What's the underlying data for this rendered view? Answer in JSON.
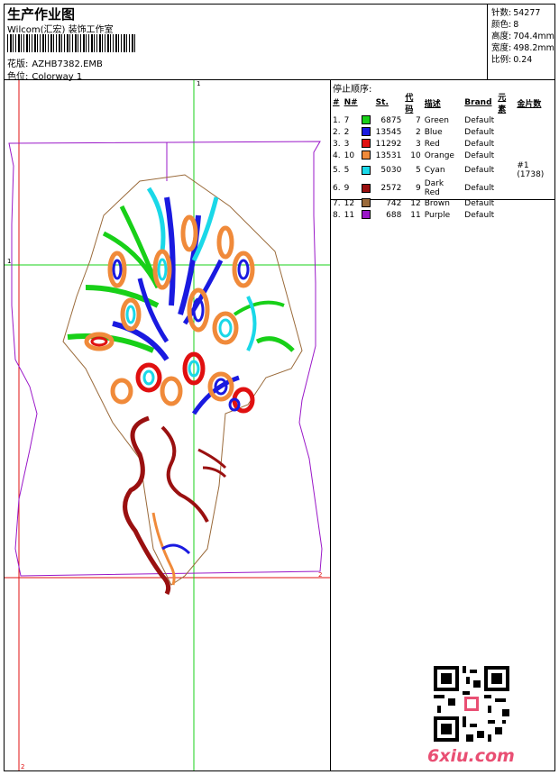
{
  "header": {
    "title": "生产作业图",
    "company": "Wilcom(汇宏) 装饰工作室",
    "design_label": "花版:",
    "design_value": "AZHB7382.EMB",
    "colorway_label": "色位:",
    "colorway_value": "Colorway 1"
  },
  "stats": [
    {
      "label": "针数:",
      "value": "54277"
    },
    {
      "label": "颜色:",
      "value": "8"
    },
    {
      "label": "高度:",
      "value": "704.4mm"
    },
    {
      "label": "宽度:",
      "value": "498.2mm"
    },
    {
      "label": "比例:",
      "value": "0.24"
    }
  ],
  "sequence": {
    "title": "停止顺序:",
    "headers": [
      "#",
      "N#",
      "St.",
      "代码",
      "描述",
      "Brand",
      "元素",
      "金片数"
    ],
    "rows": [
      {
        "no": "1.",
        "n": "7",
        "color": "#18d018",
        "st": "6875",
        "code": "7",
        "desc": "Green",
        "brand": "Default",
        "elem": "",
        "sequin": ""
      },
      {
        "no": "2.",
        "n": "2",
        "color": "#1a1ae0",
        "st": "13545",
        "code": "2",
        "desc": "Blue",
        "brand": "Default",
        "elem": "",
        "sequin": ""
      },
      {
        "no": "3.",
        "n": "3",
        "color": "#e01010",
        "st": "11292",
        "code": "3",
        "desc": "Red",
        "brand": "Default",
        "elem": "",
        "sequin": ""
      },
      {
        "no": "4.",
        "n": "10",
        "color": "#f08a3a",
        "st": "13531",
        "code": "10",
        "desc": "Orange",
        "brand": "Default",
        "elem": "",
        "sequin": ""
      },
      {
        "no": "5.",
        "n": "5",
        "color": "#1ad8e8",
        "st": "5030",
        "code": "5",
        "desc": "Cyan",
        "brand": "Default",
        "elem": "",
        "sequin": "#1 (1738)"
      },
      {
        "no": "6.",
        "n": "9",
        "color": "#9a1010",
        "st": "2572",
        "code": "9",
        "desc": "Dark Red",
        "brand": "Default",
        "elem": "",
        "sequin": ""
      },
      {
        "no": "7.",
        "n": "12",
        "color": "#9a6a3a",
        "st": "742",
        "code": "12",
        "desc": "Brown",
        "brand": "Default",
        "elem": "",
        "sequin": ""
      },
      {
        "no": "8.",
        "n": "11",
        "color": "#9a18c8",
        "st": "688",
        "code": "11",
        "desc": "Purple",
        "brand": "Default",
        "elem": "",
        "sequin": ""
      }
    ]
  },
  "axis_marks": {
    "x_top": "1",
    "y_left": "1",
    "right": "2",
    "bottom": "2"
  },
  "watermark": "6xiu.com"
}
